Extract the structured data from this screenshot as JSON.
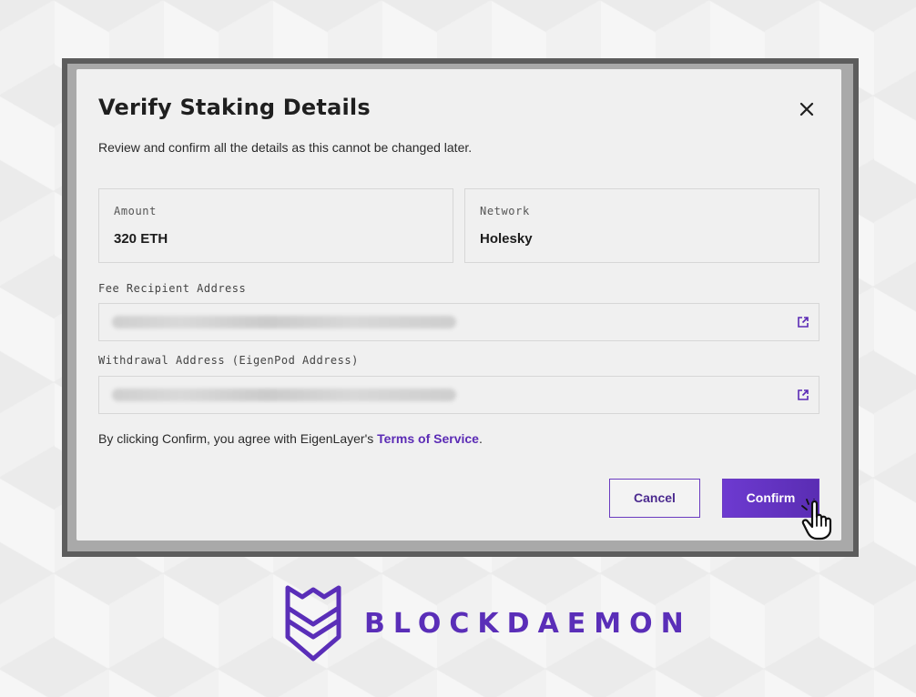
{
  "modal": {
    "title": "Verify Staking Details",
    "subtitle": "Review and confirm all the details as this cannot be changed later.",
    "amount": {
      "label": "Amount",
      "value": "320 ETH"
    },
    "network": {
      "label": "Network",
      "value": "Holesky"
    },
    "fee_recipient": {
      "label": "Fee Recipient Address"
    },
    "withdrawal": {
      "label": "Withdrawal Address (EigenPod Address)"
    },
    "terms": {
      "prefix": "By clicking Confirm, you agree with EigenLayer's ",
      "link": "Terms of Service",
      "suffix": "."
    },
    "cancel_label": "Cancel",
    "confirm_label": "Confirm"
  },
  "logo": {
    "text": "BLOCKDAEMON"
  },
  "colors": {
    "accent": "#5b2bb5",
    "brand": "#5a2eb8"
  },
  "icons": [
    "close-icon",
    "external-link-icon",
    "hand-cursor-icon",
    "blockdaemon-logo-icon"
  ]
}
